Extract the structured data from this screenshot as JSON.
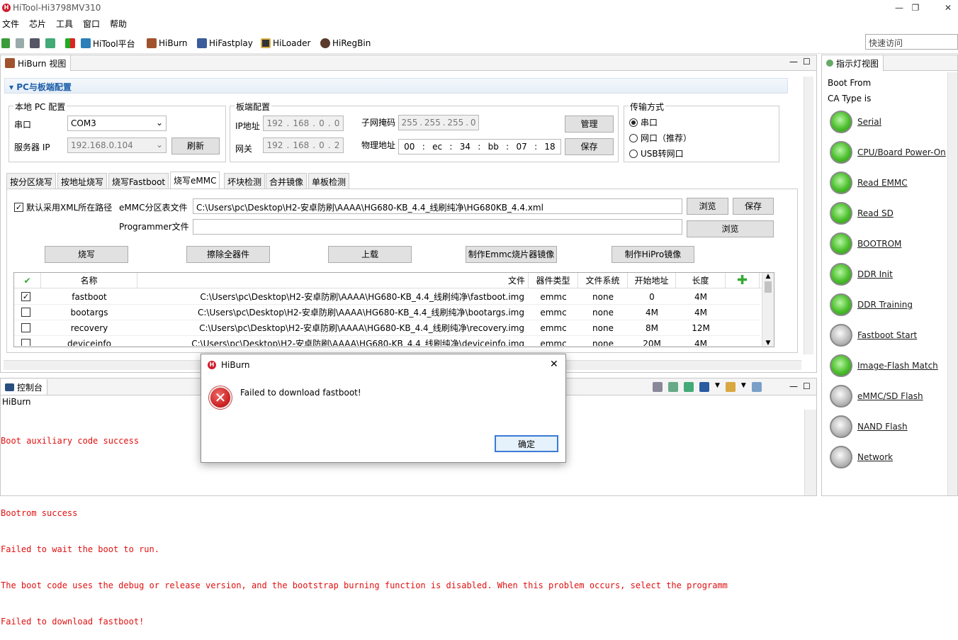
{
  "window": {
    "title": "HiTool-Hi3798MV310",
    "controls": {
      "minimize": "—",
      "maximize": "❐",
      "close": "✕"
    }
  },
  "menu": [
    "文件",
    "芯片",
    "工具",
    "窗口",
    "帮助"
  ],
  "toolbar": {
    "items": [
      "HiTool平台",
      "HiBurn",
      "HiFastplay",
      "HiLoader",
      "HiRegBin"
    ],
    "quick_access_placeholder": "快速访问"
  },
  "hiburn_view": {
    "tab_title": "HiBurn 视图",
    "section_title": "PC与板端配置",
    "local_pc": {
      "title": "本地 PC 配置",
      "serial_label": "串口",
      "serial_value": "COM3",
      "server_ip_label": "服务器 IP",
      "server_ip_value": "192.168.0.104",
      "refresh_btn": "刷新"
    },
    "board": {
      "title": "板端配置",
      "ip_label": "IP地址",
      "ip": [
        "192",
        "168",
        "0",
        "0"
      ],
      "gw_label": "网关",
      "gw": [
        "192",
        "168",
        "0",
        "2"
      ],
      "mask_label": "子网掩码",
      "mask": [
        "255",
        "255",
        "255",
        "0"
      ],
      "mac_label": "物理地址",
      "mac": [
        "00",
        "ec",
        "34",
        "bb",
        "07",
        "18"
      ],
      "manage_btn": "管理",
      "save_btn": "保存"
    },
    "transfer": {
      "title": "传输方式",
      "options": [
        "串口",
        "网口（推荐）",
        "USB转网口"
      ]
    },
    "tabs": [
      "按分区烧写",
      "按地址烧写",
      "烧写Fastboot",
      "烧写eMMC",
      "坏块检测",
      "合并镜像",
      "单板检测"
    ],
    "emmc": {
      "default_xml_label": "默认采用XML所在路径",
      "partition_label": "eMMC分区表文件",
      "partition_value": "C:\\Users\\pc\\Desktop\\H2-安卓防刷\\AAAA\\HG680-KB_4.4_线刷纯净\\HG680KB_4.4.xml",
      "browse_btn": "浏览",
      "save_btn": "保存",
      "programmer_label": "Programmer文件",
      "programmer_value": "",
      "browse2_btn": "浏览",
      "actions": [
        "烧写",
        "擦除全器件",
        "上载",
        "制作Emmc烧片器镜像",
        "制作HiPro镜像"
      ]
    },
    "table": {
      "columns": [
        "名称",
        "文件",
        "器件类型",
        "文件系统",
        "开始地址",
        "长度"
      ],
      "rows": [
        {
          "checked": "✓",
          "name": "fastboot",
          "file": "C:\\Users\\pc\\Desktop\\H2-安卓防刷\\AAAA\\HG680-KB_4.4_线刷纯净\\fastboot.img",
          "type": "emmc",
          "fs": "none",
          "start": "0",
          "len": "4M"
        },
        {
          "checked": "",
          "name": "bootargs",
          "file": "C:\\Users\\pc\\Desktop\\H2-安卓防刷\\AAAA\\HG680-KB_4.4_线刷纯净\\bootargs.img",
          "type": "emmc",
          "fs": "none",
          "start": "4M",
          "len": "4M"
        },
        {
          "checked": "",
          "name": "recovery",
          "file": "C:\\Users\\pc\\Desktop\\H2-安卓防刷\\AAAA\\HG680-KB_4.4_线刷纯净\\recovery.img",
          "type": "emmc",
          "fs": "none",
          "start": "8M",
          "len": "12M"
        },
        {
          "checked": "",
          "name": "deviceinfo",
          "file": "C:\\Users\\pc\\Desktop\\H2-安卓防刷\\AAAA\\HG680-KB_4.4_线刷纯净\\deviceinfo.img",
          "type": "emmc",
          "fs": "none",
          "start": "20M",
          "len": "4M"
        }
      ]
    }
  },
  "indicator_view": {
    "tab_title": "指示灯视图",
    "boot_from": "Boot From",
    "ca_type": "CA Type is",
    "leds": [
      {
        "label": "Serial",
        "state": "green"
      },
      {
        "label": "CPU/Board Power-On",
        "state": "green"
      },
      {
        "label": "Read EMMC",
        "state": "green"
      },
      {
        "label": "Read SD ",
        "state": "green"
      },
      {
        "label": "BOOTROM",
        "state": "green"
      },
      {
        "label": "DDR Init",
        "state": "green"
      },
      {
        "label": "DDR Training",
        "state": "green"
      },
      {
        "label": "Fastboot Start",
        "state": "gray"
      },
      {
        "label": "Image-Flash Match",
        "state": "green"
      },
      {
        "label": "eMMC/SD Flash",
        "state": "gray"
      },
      {
        "label": "NAND Flash",
        "state": "gray"
      },
      {
        "label": "Network",
        "state": "gray"
      }
    ]
  },
  "console": {
    "tab_title": "控制台",
    "source": "HiBurn",
    "lines": [
      "Boot auxiliary code success",
      "",
      "Bootrom success",
      "Failed to wait the boot to run.",
      "The boot code uses the debug or release version, and the bootstrap burning function is disabled. When this problem occurs, select the programm",
      "Failed to download fastboot!"
    ]
  },
  "dialog": {
    "title": "HiBurn",
    "message": "Failed to download fastboot!",
    "ok_btn": "确定",
    "close": "✕"
  }
}
